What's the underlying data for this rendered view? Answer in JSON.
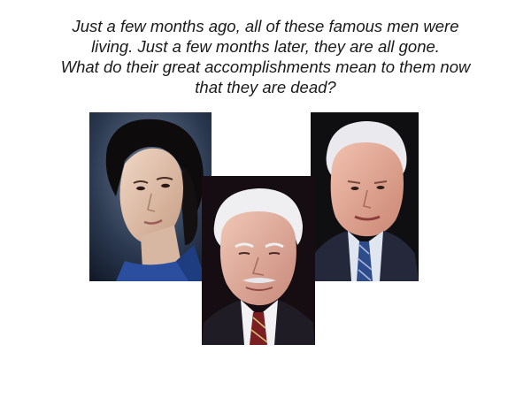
{
  "caption": {
    "lines": [
      "Just a few months ago, all of these famous men were",
      "living. Just a few months later, they are all gone.",
      "What do their great accomplishments mean to them now",
      "that they are dead?"
    ]
  },
  "photos": [
    {
      "subject": "portrait-left",
      "background": "#1e2c3e"
    },
    {
      "subject": "portrait-center",
      "background": "#150d12"
    },
    {
      "subject": "portrait-right",
      "background": "#0f0f12"
    }
  ]
}
